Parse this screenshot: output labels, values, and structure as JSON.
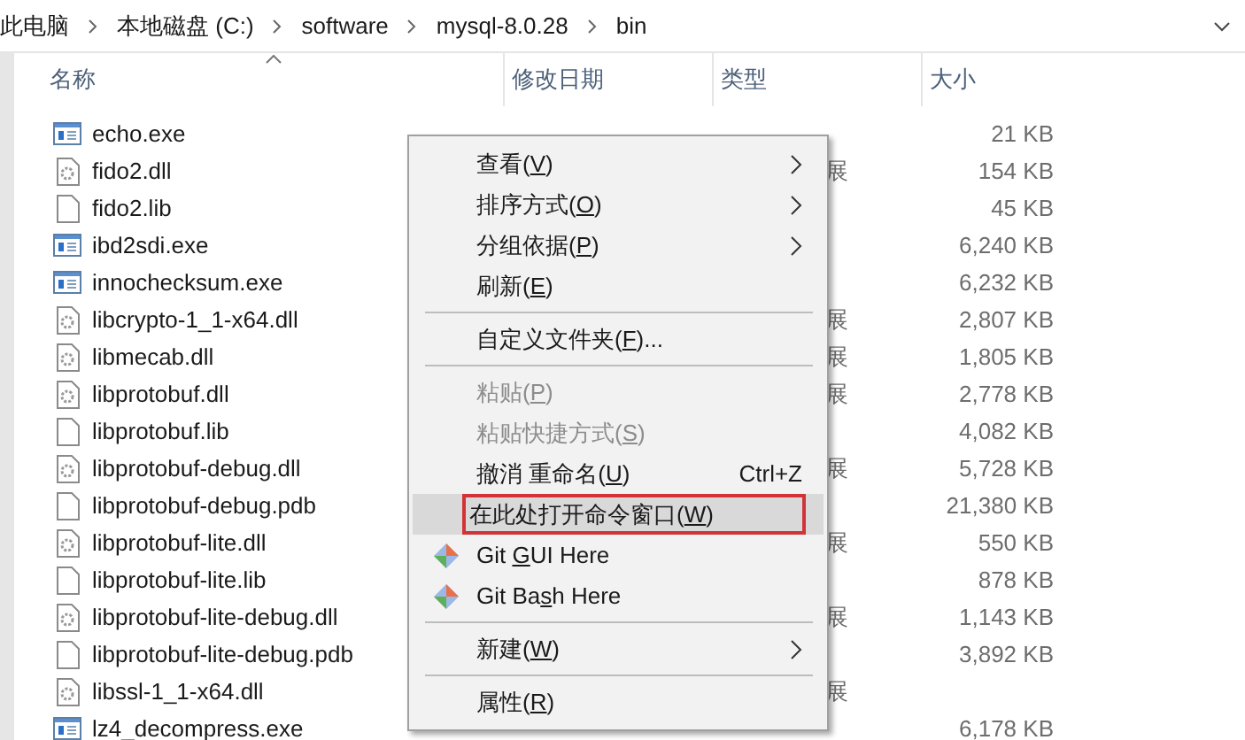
{
  "breadcrumb": [
    "此电脑",
    "本地磁盘 (C:)",
    "software",
    "mysql-8.0.28",
    "bin"
  ],
  "columns": [
    "名称",
    "修改日期",
    "类型",
    "大小"
  ],
  "files": [
    {
      "name": "echo.exe",
      "kind": "exe",
      "size": "21 KB"
    },
    {
      "name": "fido2.dll",
      "kind": "dll",
      "type": "展",
      "size": "154 KB"
    },
    {
      "name": "fido2.lib",
      "kind": "file",
      "size": "45 KB"
    },
    {
      "name": "ibd2sdi.exe",
      "kind": "exe",
      "size": "6,240 KB"
    },
    {
      "name": "innochecksum.exe",
      "kind": "exe",
      "size": "6,232 KB"
    },
    {
      "name": "libcrypto-1_1-x64.dll",
      "kind": "dll",
      "type": "展",
      "size": "2,807 KB"
    },
    {
      "name": "libmecab.dll",
      "kind": "dll",
      "type": "展",
      "size": "1,805 KB"
    },
    {
      "name": "libprotobuf.dll",
      "kind": "dll",
      "type": "展",
      "size": "2,778 KB"
    },
    {
      "name": "libprotobuf.lib",
      "kind": "file",
      "size": "4,082 KB"
    },
    {
      "name": "libprotobuf-debug.dll",
      "kind": "dll",
      "type": "展",
      "size": "5,728 KB"
    },
    {
      "name": "libprotobuf-debug.pdb",
      "kind": "file",
      "size": "21,380 KB"
    },
    {
      "name": "libprotobuf-lite.dll",
      "kind": "dll",
      "type": "展",
      "size": "550 KB"
    },
    {
      "name": "libprotobuf-lite.lib",
      "kind": "file",
      "size": "878 KB"
    },
    {
      "name": "libprotobuf-lite-debug.dll",
      "kind": "dll",
      "type": "展",
      "size": "1,143 KB"
    },
    {
      "name": "libprotobuf-lite-debug.pdb",
      "kind": "file",
      "size": "3,892 KB"
    },
    {
      "name": "libssl-1_1-x64.dll",
      "kind": "dll",
      "type": "展"
    },
    {
      "name": "lz4_decompress.exe",
      "kind": "exe",
      "size": "6,178 KB"
    }
  ],
  "context_menu": [
    {
      "kind": "submenu",
      "before": "查看(",
      "key": "V",
      "after": ")",
      "disabled": false,
      "selected": false
    },
    {
      "kind": "submenu",
      "before": "排序方式(",
      "key": "O",
      "after": ")",
      "disabled": false,
      "selected": false
    },
    {
      "kind": "submenu",
      "before": "分组依据(",
      "key": "P",
      "after": ")",
      "disabled": false,
      "selected": false
    },
    {
      "kind": "item",
      "before": "刷新(",
      "key": "E",
      "after": ")",
      "disabled": false,
      "selected": false
    },
    {
      "kind": "separator"
    },
    {
      "kind": "item",
      "before": "自定义文件夹(",
      "key": "F",
      "after": ")...",
      "disabled": false,
      "selected": false
    },
    {
      "kind": "separator"
    },
    {
      "kind": "item",
      "before": "粘贴(",
      "key": "P",
      "after": ")",
      "disabled": true,
      "selected": false
    },
    {
      "kind": "item",
      "before": "粘贴快捷方式(",
      "key": "S",
      "after": ")",
      "disabled": true,
      "selected": false
    },
    {
      "kind": "item",
      "before": "撤消 重命名(",
      "key": "U",
      "after": ")",
      "shortcut": "Ctrl+Z",
      "disabled": false,
      "selected": false
    },
    {
      "kind": "item",
      "before": "在此处打开命令窗口(",
      "key": "W",
      "after": ")",
      "disabled": false,
      "selected": true
    },
    {
      "kind": "git",
      "before": "Git ",
      "key": "G",
      "after": "UI Here",
      "disabled": false,
      "selected": false
    },
    {
      "kind": "git",
      "before": "Git Ba",
      "key": "s",
      "after": "h Here",
      "disabled": false,
      "selected": false
    },
    {
      "kind": "separator"
    },
    {
      "kind": "submenu",
      "before": "新建(",
      "key": "W",
      "after": ")",
      "disabled": false,
      "selected": false
    },
    {
      "kind": "separator"
    },
    {
      "kind": "item",
      "before": "属性(",
      "key": "R",
      "after": ")",
      "disabled": false,
      "selected": false
    }
  ]
}
